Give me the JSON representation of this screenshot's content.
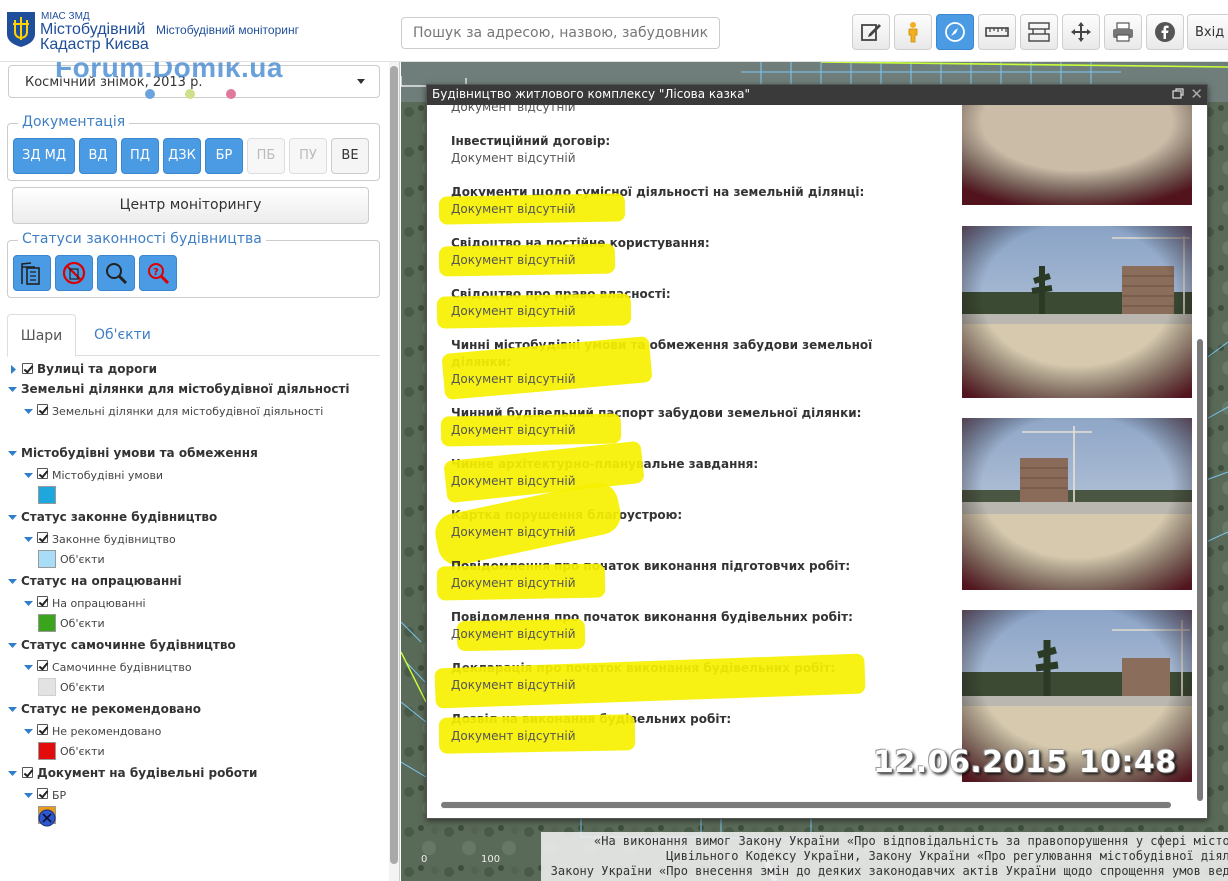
{
  "header": {
    "logo_small": "МІАС ЗМД",
    "logo_line1": "Містобудівний",
    "logo_line2": "Кадастр Києва",
    "logo_subtitle": "Містобудівний моніторинг",
    "search_placeholder": "Пошук за адресою, назвою, забудовником...",
    "toolbar": [
      {
        "name": "edit-icon",
        "active": false
      },
      {
        "name": "street-view-person-icon",
        "active": false
      },
      {
        "name": "compass-icon",
        "active": true
      },
      {
        "name": "ruler-icon",
        "active": false
      },
      {
        "name": "area-measure-icon",
        "active": false
      },
      {
        "name": "move-arrows-icon",
        "active": false
      },
      {
        "name": "printer-icon",
        "active": false
      },
      {
        "name": "facebook-icon",
        "active": false
      }
    ],
    "exit_label": "Вхід"
  },
  "sidebar": {
    "basemap_value": "Космічний знімок, 2013 р.",
    "watermark": "Forum.Domik.ua",
    "documentation": {
      "legend": "Документація",
      "buttons": [
        {
          "label": "ЗД МД",
          "state": "active"
        },
        {
          "label": "ВД",
          "state": "active"
        },
        {
          "label": "ПД",
          "state": "active"
        },
        {
          "label": "ДЗК",
          "state": "active"
        },
        {
          "label": "БР",
          "state": "active"
        },
        {
          "label": "ПБ",
          "state": "disabled"
        },
        {
          "label": "ПУ",
          "state": "disabled"
        },
        {
          "label": "ВЕ",
          "state": "light"
        }
      ]
    },
    "monitoring_center_label": "Центр моніторингу",
    "statuses": {
      "legend": "Статуси законності будівництва",
      "icons": [
        "legal-construction-icon",
        "no-construction-icon",
        "search-magnifier-icon",
        "question-magnifier-icon"
      ]
    },
    "tabs": {
      "layers": "Шари",
      "objects": "Об'єкти"
    },
    "layers": {
      "streets": "Вулиці та дороги",
      "land_group": "Земельні ділянки для містобудівної діяльності",
      "land_sub": "Земельні ділянки для містобудівної діяльності",
      "conditions_group": "Містобудівні умови та обмеження",
      "conditions_sub": "Містобудівні умови",
      "legal_group": "Статус законне будівництво",
      "legal_sub": "Законне будівництво",
      "legal_objects": "Об'єкти",
      "processing_group": "Статус на опрацюванні",
      "processing_sub": "На опрацюванні",
      "processing_objects": "Об'єкти",
      "illegal_group": "Статус самочинне будівництво",
      "illegal_sub": "Самочинне будівництво",
      "illegal_objects": "Об'єкти",
      "notrec_group": "Статус не рекомендовано",
      "notrec_sub": "Не рекомендовано",
      "notrec_objects": "Об'єкти",
      "permit_group": "Документ на будівельні роботи",
      "permit_sub": "БР"
    },
    "swatch_colors": {
      "land": "#1ea7dc",
      "conditions": "#a9dcf7",
      "legal": "#3aa51b",
      "processing": "#e3e3e3",
      "illegal": "#e30c0c",
      "notrec": "#eb9c16",
      "permit": "#2f58d0"
    }
  },
  "map": {
    "scale_zero": "0",
    "scale_value": "100",
    "legal_notice": [
      "«На виконання вимог Закону України «Про відповідальність за правопорушення у сфері містоб",
      "Цивільного Кодексу України, Закону України «Про регулювання містобудівної діяль",
      "Закону України «Про внесення змін до деяких законодавчих актів України щодо спрощення умов веде"
    ]
  },
  "popup": {
    "title": "Будівництво житлового комплексу \"Лісова казка\"",
    "top_status": "Документ відсутній",
    "items": [
      {
        "title": "Інвестиційний договір:",
        "status": "Документ відсутній"
      },
      {
        "title": "Документи щодо сумісної діяльності на земельній ділянці:",
        "status": "Документ відсутній"
      },
      {
        "title": "Свідоцтво на постійне користування:",
        "status": "Документ відсутній"
      },
      {
        "title": "Свідоцтво про право власності:",
        "status": "Документ відсутній"
      },
      {
        "title": "Чинні містобудівні умови та обмеження забудови земельної ділянки:",
        "status": "Документ відсутній"
      },
      {
        "title": "Чинний будівельний паспорт забудови земельної ділянки:",
        "status": "Документ відсутній"
      },
      {
        "title": "Чинне архітектурно-планувальне завдання:",
        "status": "Документ відсутній"
      },
      {
        "title": "Картка порушення благоустрою:",
        "status": "Документ відсутній"
      },
      {
        "title": "Повідомлення про початок виконання підготовчих робіт:",
        "status": "Документ відсутній"
      },
      {
        "title": "Повідомлення про початок виконання будівельних робіт:",
        "status": "Документ відсутній"
      },
      {
        "title": "Декларація про початок виконання будівельних робіт:",
        "status": "Документ відсутній"
      },
      {
        "title": "Дозвіл на виконання будівельних робіт:",
        "status": "Документ відсутній"
      }
    ],
    "photo_timestamp": "12.06.2015 10:48",
    "highlight_color": "#f6f000"
  }
}
